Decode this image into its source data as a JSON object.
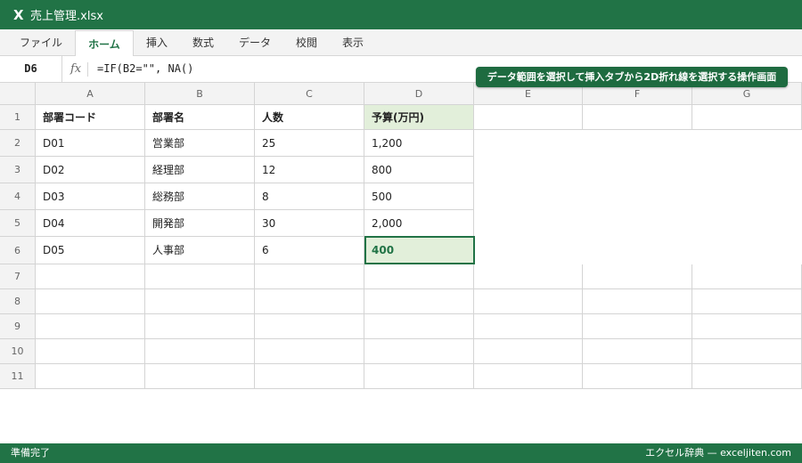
{
  "window": {
    "logo": "X",
    "title": "売上管理.xlsx"
  },
  "ribbon": {
    "tabs": [
      "ファイル",
      "ホーム",
      "挿入",
      "数式",
      "データ",
      "校閲",
      "表示"
    ],
    "active_tab": "ホーム"
  },
  "formula_bar": {
    "name_box": "D6",
    "fx": "fx",
    "formula": "=IF(B2=\"\", NA()"
  },
  "note": "データ範囲を選択して挿入タブから2D折れ線を選択する操作画面",
  "sheet": {
    "columns": [
      "A",
      "B",
      "C",
      "D",
      "E",
      "F",
      "G"
    ],
    "rows": [
      "1",
      "2",
      "3",
      "4",
      "5",
      "6",
      "7",
      "8",
      "9",
      "10",
      "11"
    ],
    "headers": [
      "部署コード",
      "部署名",
      "人数",
      "予算(万円)"
    ],
    "data": [
      [
        "D01",
        "営業部",
        "25",
        "1,200"
      ],
      [
        "D02",
        "経理部",
        "12",
        "800"
      ],
      [
        "D03",
        "総務部",
        "8",
        "500"
      ],
      [
        "D04",
        "開発部",
        "30",
        "2,000"
      ],
      [
        "D05",
        "人事部",
        "6",
        "400"
      ]
    ],
    "selected_cell": "D6"
  },
  "status": {
    "left": "準備完了",
    "right": "エクセル辞典 — exceljiten.com"
  },
  "colors": {
    "accent": "#217346",
    "highlight": "#e2efda"
  }
}
